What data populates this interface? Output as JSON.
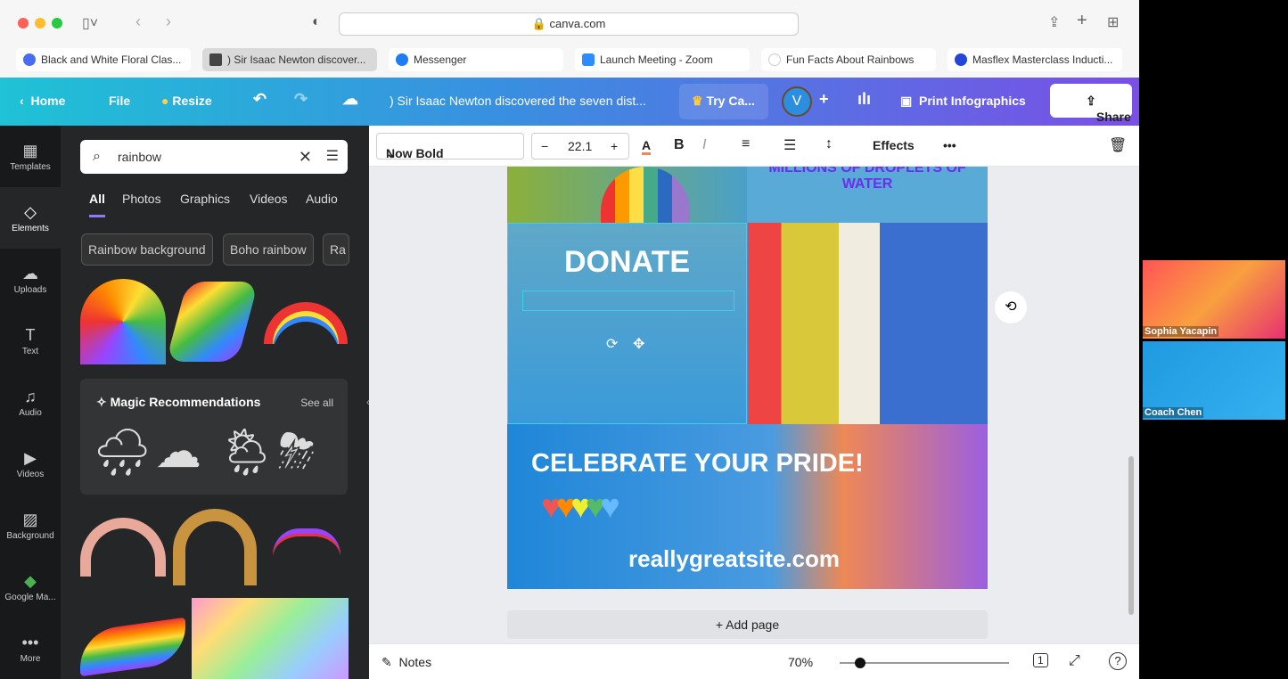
{
  "browser": {
    "url": "canva.com",
    "tabs": [
      {
        "label": "Black and White Floral Clas...",
        "color": "#4a6cf0"
      },
      {
        "label": ") Sir Isaac Newton discover...",
        "color": "#444",
        "active": true
      },
      {
        "label": "Messenger",
        "color": "#1e7cf5"
      },
      {
        "label": "Launch Meeting - Zoom",
        "color": "#2d8cff"
      },
      {
        "label": "Fun Facts About Rainbows",
        "color": "#ddd"
      },
      {
        "label": "Masflex Masterclass Inducti...",
        "color": "#2446d8"
      }
    ]
  },
  "topbar": {
    "home": "Home",
    "file": "File",
    "resize": "Resize",
    "title": ") Sir Isaac Newton discovered the seven dist...",
    "try": "Try Ca...",
    "avatar": "V",
    "print": "Print Infographics",
    "share": "Share"
  },
  "rail": [
    {
      "label": "Templates",
      "icon": "▦"
    },
    {
      "label": "Elements",
      "icon": "◇"
    },
    {
      "label": "Uploads",
      "icon": "☁"
    },
    {
      "label": "Text",
      "icon": "T"
    },
    {
      "label": "Audio",
      "icon": "♫"
    },
    {
      "label": "Videos",
      "icon": "▶"
    },
    {
      "label": "Background",
      "icon": "▨"
    },
    {
      "label": "Google Ma...",
      "icon": "◆"
    },
    {
      "label": "More",
      "icon": "•••"
    }
  ],
  "panel": {
    "search_value": "rainbow",
    "tabs": [
      "All",
      "Photos",
      "Graphics",
      "Videos",
      "Audio"
    ],
    "chips": [
      "Rainbow background",
      "Boho rainbow",
      "Ra"
    ],
    "magic_title": "Magic Recommendations",
    "see_all": "See all"
  },
  "toolbar": {
    "font": "Now Bold",
    "size": "22.1",
    "effects": "Effects"
  },
  "design": {
    "top_text_partial": "MILLIONS OF DROPLETS OF",
    "top_text": "WATER",
    "donate": "DONATE",
    "celebrate": "CELEBRATE YOUR PRIDE!",
    "site": "reallygreatsite.com",
    "add_page": "+ Add page"
  },
  "bottombar": {
    "notes": "Notes",
    "zoom": "70%",
    "zoom_fraction": 0.12,
    "page": "1"
  },
  "video": [
    {
      "name": "Sophia Yacapin"
    },
    {
      "name": "Coach Chen"
    }
  ]
}
